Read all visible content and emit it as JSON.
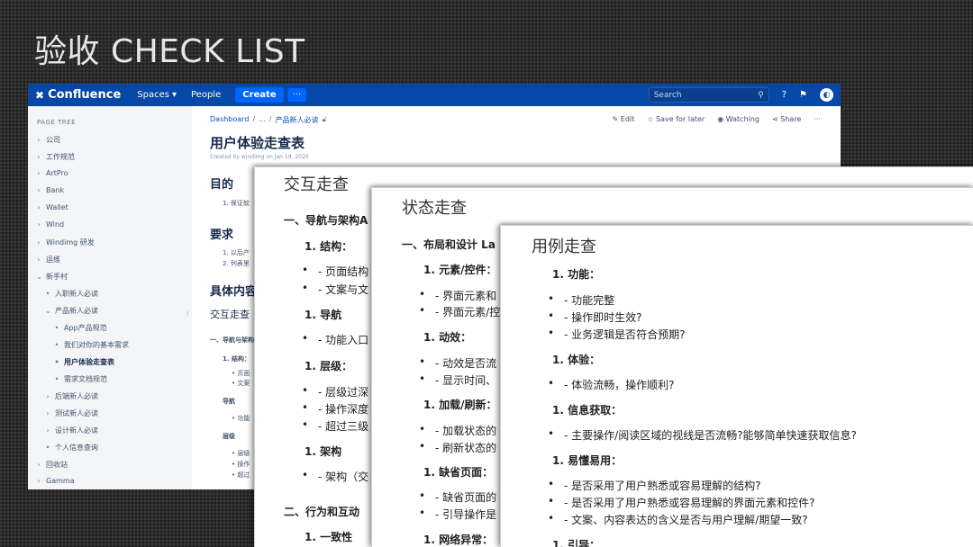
{
  "slide_title": "验收 CHECK LIST",
  "confluence": {
    "topbar": {
      "logo": "Confluence",
      "spaces": "Spaces",
      "people": "People",
      "create": "Create",
      "more": "···",
      "search_placeholder": "Search"
    },
    "sidebar": {
      "label": "PAGE TREE",
      "items": [
        {
          "label": "公司",
          "marker": "›"
        },
        {
          "label": "工作规范",
          "marker": "›"
        },
        {
          "label": "ArtPro",
          "marker": "›"
        },
        {
          "label": "Bank",
          "marker": "›"
        },
        {
          "label": "Wallet",
          "marker": "›"
        },
        {
          "label": "Wind",
          "marker": "›"
        },
        {
          "label": "Windimg 研发",
          "marker": "›"
        },
        {
          "label": "运维",
          "marker": "›"
        },
        {
          "label": "新手村",
          "marker": "⌄"
        },
        {
          "label": "入职新人必读",
          "marker": "•"
        },
        {
          "label": "产品新人必读",
          "marker": "⌄"
        },
        {
          "label": "App产品规范",
          "marker": "•"
        },
        {
          "label": "我们对你的基本需求",
          "marker": "•"
        },
        {
          "label": "用户体验走查表",
          "marker": "•"
        },
        {
          "label": "需求文档规范",
          "marker": "•"
        },
        {
          "label": "后端新人必读",
          "marker": "›"
        },
        {
          "label": "测试新人必读",
          "marker": "›"
        },
        {
          "label": "设计新人必读",
          "marker": "›"
        },
        {
          "label": "个人信息查询",
          "marker": "•"
        },
        {
          "label": "回收站",
          "marker": "›"
        },
        {
          "label": "Gamma",
          "marker": "›"
        }
      ]
    },
    "breadcrumb": {
      "root": "Dashboard",
      "ellipsis": "...",
      "parent": "产品新人必读"
    },
    "actions": {
      "edit": "Edit",
      "save": "Save for later",
      "watch": "Watching",
      "share": "Share",
      "more": "···"
    },
    "page": {
      "title": "用户体验走查表",
      "meta": "Created by windimg on Jan 19, 2020",
      "h_purpose": "目的",
      "purpose_item": "1. 保证软",
      "h_requirement": "要求",
      "req_1": "1. 以后产",
      "req_2": "2. 列表里",
      "h_content": "具体内容",
      "sub_interaction": "交互走查",
      "nav_head": "一、导航与架构",
      "s1": "1. 结构：",
      "s1a": "• 页面",
      "s1b": "• 文案",
      "s2": "导航",
      "s2a": "• 功能",
      "s3": "层级",
      "s3a": "• 层级",
      "s3b": "• 操作",
      "s3c": "• 超过"
    }
  },
  "sheet_interaction": {
    "title": "交互走查",
    "h1": "一、导航与架构A",
    "structure": "1. 结构：",
    "structure_1": "- 页面结构",
    "structure_2": "- 文案与文",
    "nav": "1. 导航",
    "nav_1": "- 功能入口",
    "level": "1. 层级：",
    "level_1": "- 层级过深",
    "level_2": "- 操作深度",
    "level_3": "- 超过三级",
    "arch": "1. 架构",
    "arch_1": "- 架构（交",
    "h2": "二、行为和互动",
    "consistency": "1. 一致性"
  },
  "sheet_state": {
    "title": "状态走查",
    "h1": "一、布局和设计 La",
    "elements": "1. 元素/控件：",
    "elements_1": "- 界面元素和",
    "elements_2": "- 界面元素/控",
    "motion": "1. 动效：",
    "motion_1": "- 动效是否流",
    "motion_2": "- 显示时间、",
    "loading": "1. 加载/刷新：",
    "loading_1": "- 加载状态的",
    "loading_2": "- 刷新状态的",
    "empty": "1. 缺省页面：",
    "empty_1": "- 缺省页面的",
    "empty_2": "- 引导操作是",
    "network": "1. 网络异常："
  },
  "sheet_usecase": {
    "title": "用例走查",
    "function": "1. 功能：",
    "function_1": "- 功能完整",
    "function_2": "- 操作即时生效?",
    "function_3": "- 业务逻辑是否符合预期?",
    "experience": "1. 体验：",
    "experience_1": "- 体验流畅，操作顺利?",
    "info": "1. 信息获取：",
    "info_1": "- 主要操作/阅读区域的视线是否流畅?能够简单快速获取信息?",
    "easy": "1. 易懂易用：",
    "easy_1": "- 是否采用了用户熟悉或容易理解的结构?",
    "easy_2": "- 是否采用了用户熟悉或容易理解的界面元素和控件?",
    "easy_3": "- 文案、内容表达的含义是否与用户理解/期望一致?",
    "guide": "1. 引导："
  }
}
